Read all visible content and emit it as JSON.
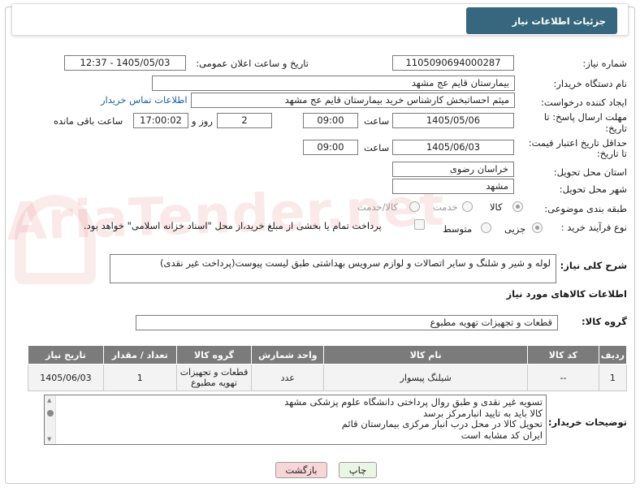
{
  "header": {
    "title": "جزئیات اطلاعات نیاز"
  },
  "fields": {
    "need_number_label": "شماره نیاز:",
    "need_number": "1105090694000287",
    "announce_label": "تاریخ و ساعت اعلان عمومی:",
    "announce_value": "1405/05/03 - 12:37",
    "buyer_org_label": "نام دستگاه خریدار:",
    "buyer_org": "بیمارستان قایم  عج  مشهد",
    "creator_label": "ایجاد کننده درخواست:",
    "creator": "میثم احساتبخش کارشناس خرید بیمارستان قایم  عج  مشهد",
    "contact_link": "اطلاعات تماس خریدار",
    "deadline_label_1": "مهلت ارسال پاسخ: تا",
    "deadline_label_2": "تاریخ:",
    "deadline_date": "1405/05/06",
    "time_label": "ساعت",
    "deadline_time": "09:00",
    "days_value": "2",
    "days_label": "روز و",
    "remaining_time": "17:00:02",
    "remaining_label": "ساعت باقی مانده",
    "min_price_label_1": "حداقل تاریخ اعتبار قیمت:",
    "min_price_label_2": "تا تاریخ:",
    "min_price_date": "1405/06/03",
    "min_price_time": "09:00",
    "province_label": "استان محل تحویل:",
    "province": "خراسان رضوی",
    "city_label": "شهر محل تحویل:",
    "city": "مشهد",
    "category_label": "طبقه بندی موضوعی:",
    "category_options": [
      "کالا",
      "خدمت",
      "کالا/خدمت"
    ],
    "process_label": "نوع فرآیند خرید :",
    "process_options": [
      "جزیی",
      "متوسط"
    ],
    "payment_note": "پرداخت تمام یا بخشی از مبلغ خرید،از محل \"اسناد خزانه اسلامی\" خواهد بود."
  },
  "summary": {
    "label": "شرح کلی نیاز:",
    "text": "لوله و شیر و شلنگ و سایر اتصالات و لوازم سرویس بهداشتی طبق لیست پیوست(پرداخت غیر نقدی)"
  },
  "goods": {
    "section_title": "اطلاعات کالاهای مورد نیاز",
    "group_label": "گروه کالا:",
    "group_value": "قطعات و تجهیزات تهویه مطبوع",
    "columns": [
      "ردیف",
      "کد کالا",
      "نام کالا",
      "واحد شمارش",
      "گروه کالا",
      "تعداد / مقدار",
      "تاریخ نیاز"
    ],
    "rows": [
      {
        "row": "1",
        "code": "--",
        "name": "شیلنگ پیسوار",
        "unit": "عدد",
        "group": "قطعات و تجهیزات تهویه مطبوع",
        "qty": "1",
        "date": "1405/06/03"
      }
    ]
  },
  "buyer_notes": {
    "label": "توضیحات خریدار:",
    "lines": [
      "تسویه غیر نقدی و طبق روال پرداختی دانشگاه علوم پزشکی مشهد",
      "کالا باید به تایید انبارمرکز برسد",
      "تحویل کالا در محل درب انبار مرکزی بیمارستان قائم",
      "ایران کد مشابه است"
    ]
  },
  "buttons": {
    "print": "چاپ",
    "back": "بازگشت"
  },
  "watermark": "AriaTender.net",
  "colors": {
    "header_bg": "#37677e",
    "table_header_bg": "#7b7b7b",
    "back_btn_bg": "#f6d6d6",
    "print_btn_bg": "#eaf6e4"
  }
}
